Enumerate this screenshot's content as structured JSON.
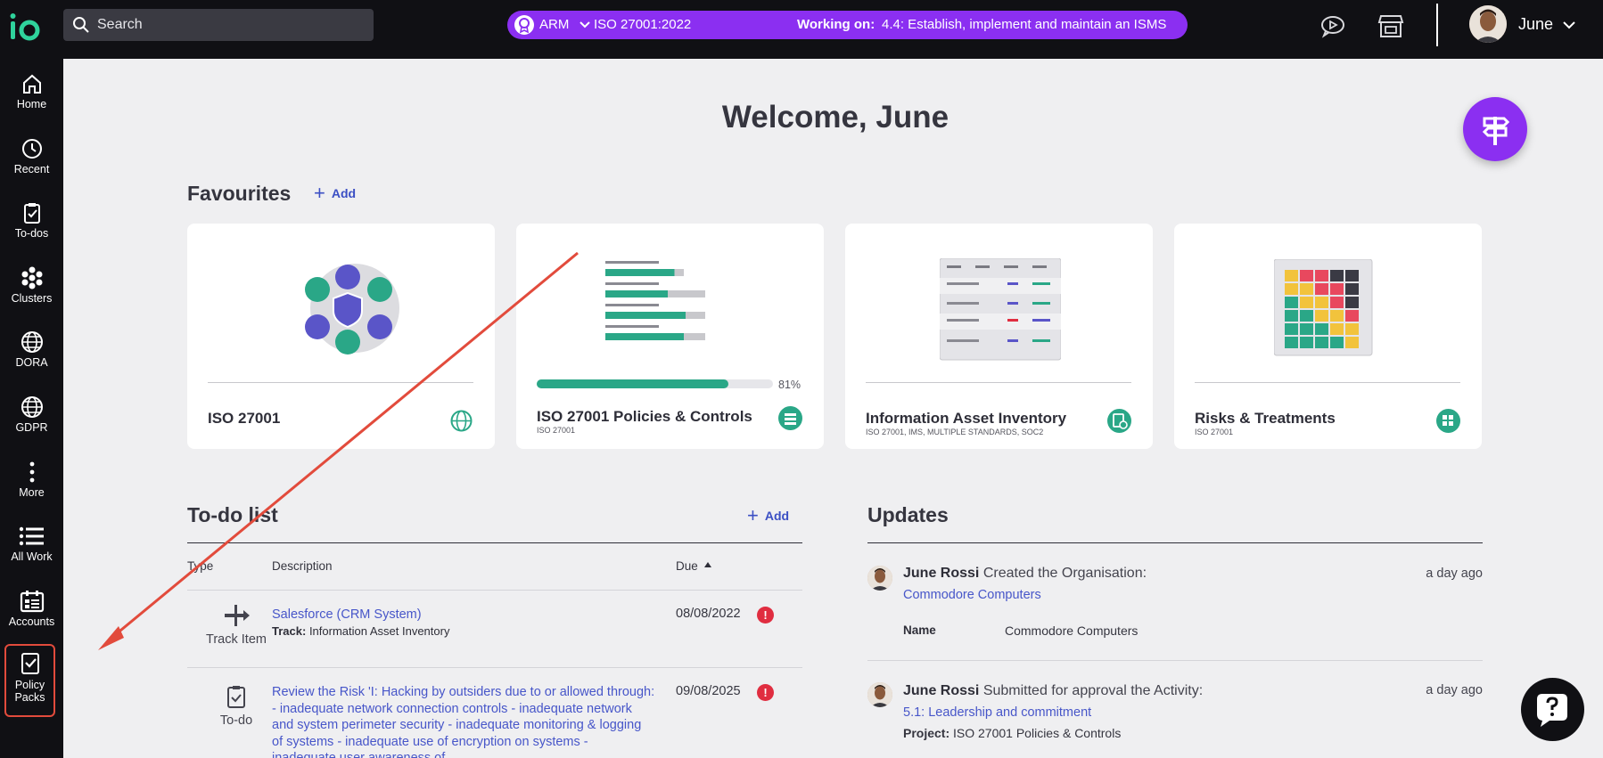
{
  "search": {
    "placeholder": "Search"
  },
  "context": {
    "org": "ARM",
    "standard": "ISO 27001:2022",
    "working_label": "Working on:",
    "working_value": "4.4: Establish, implement and maintain an ISMS"
  },
  "user": {
    "name": "June"
  },
  "sidebar": {
    "items": [
      {
        "label": "Home",
        "icon": "home-icon"
      },
      {
        "label": "Recent",
        "icon": "history-icon"
      },
      {
        "label": "To-dos",
        "icon": "clipboard-check-icon"
      },
      {
        "label": "Clusters",
        "icon": "dots-grid-icon"
      },
      {
        "label": "DORA",
        "icon": "globe-icon"
      },
      {
        "label": "GDPR",
        "icon": "globe-icon"
      },
      {
        "label": "More",
        "icon": "more-vertical-icon"
      },
      {
        "label": "All Work",
        "icon": "list-icon"
      },
      {
        "label": "Accounts",
        "icon": "calendar-grid-icon"
      },
      {
        "label": "Policy Packs",
        "icon": "policy-check-icon"
      }
    ]
  },
  "main": {
    "welcome": "Welcome, June",
    "favourites": {
      "title": "Favourites",
      "add_label": "Add",
      "cards": [
        {
          "title": "ISO 27001",
          "subtitle": ""
        },
        {
          "title": "ISO 27001 Policies & Controls",
          "subtitle": "ISO 27001",
          "progress": 0.81,
          "progress_label": "81%"
        },
        {
          "title": "Information Asset Inventory",
          "subtitle": "ISO 27001, IMS, MULTIPLE STANDARDS, SOC2"
        },
        {
          "title": "Risks & Treatments",
          "subtitle": "ISO 27001"
        }
      ]
    },
    "todo": {
      "title": "To-do list",
      "add_label": "Add",
      "columns": {
        "type": "Type",
        "description": "Description",
        "due": "Due"
      },
      "rows": [
        {
          "type": "Track Item",
          "description": "Salesforce (CRM System)",
          "meta_label": "Track:",
          "meta_value": "Information Asset Inventory",
          "due": "08/08/2022",
          "alert": "!"
        },
        {
          "type": "To-do",
          "description": "Review the Risk 'I: Hacking by outsiders due to or allowed through: - inadequate network connection controls - inadequate network and system perimeter security - inadequate monitoring & logging of systems - inadequate use of encryption on systems - inadequate user awareness of",
          "due": "09/08/2025",
          "alert": "!"
        }
      ]
    },
    "updates": {
      "title": "Updates",
      "items": [
        {
          "user": "June Rossi",
          "action": "Created the Organisation:",
          "link": "Commodore Computers",
          "time": "a day ago",
          "detail_key": "Name",
          "detail_value": "Commodore Computers"
        },
        {
          "user": "June Rossi",
          "action": "Submitted for approval the Activity:",
          "link": "5.1: Leadership and commitment",
          "time": "a day ago",
          "detail_key": "Project:",
          "detail_value": "ISO 27001 Policies & Controls"
        }
      ]
    }
  },
  "colors": {
    "brand_purple": "#8b2ff1",
    "accent_green": "#2aa787",
    "link_blue": "#4756c9",
    "alert_red": "#e02d40",
    "annotation_red": "#e24b3c"
  }
}
